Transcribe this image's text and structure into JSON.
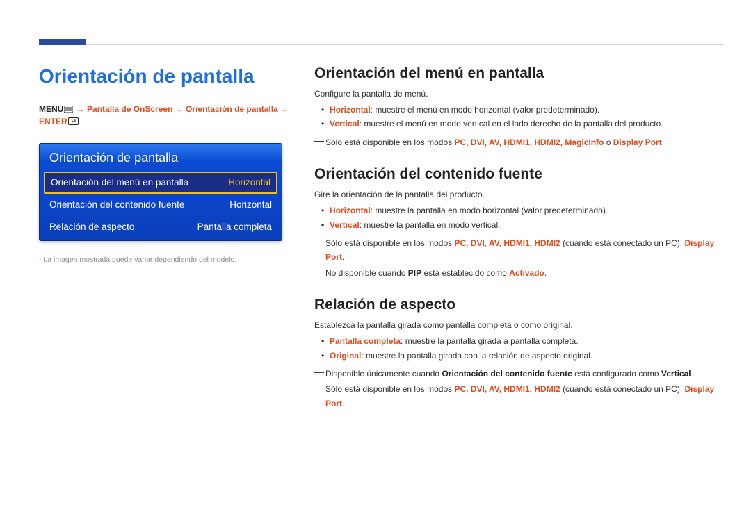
{
  "left": {
    "title": "Orientación de pantalla",
    "breadcrumb": {
      "menu_label": "MENU",
      "path_1": " → Pantalla de OnScreen → Orientación de pantalla → ENTER"
    },
    "osd": {
      "title": "Orientación de pantalla",
      "rows": [
        {
          "label": "Orientación del menú en pantalla",
          "value": "Horizontal",
          "selected": true
        },
        {
          "label": "Orientación del contenido fuente",
          "value": "Horizontal",
          "selected": false
        },
        {
          "label": "Relación de aspecto",
          "value": "Pantalla completa",
          "selected": false
        }
      ]
    },
    "footnote_prefix": "-",
    "footnote": "La imagen mostrada puede variar dependiendo del modelo."
  },
  "right": {
    "section1": {
      "heading": "Orientación del menú en pantalla",
      "intro": "Configure la pantalla de menú.",
      "bullet1_strong": "Horizontal",
      "bullet1_rest": ": muestre el menú en modo horizontal (valor predeterminado).",
      "bullet2_strong": "Vertical",
      "bullet2_rest": ": muestre el menú en modo vertical en el lado derecho de la pantalla del producto.",
      "note1_a": "Sólo está disponible en los modos ",
      "note1_modes": "PC, DVI, AV, HDMI1, HDMI2, MagicInfo",
      "note1_o": " o ",
      "note1_dp": "Display Port",
      "note1_end": "."
    },
    "section2": {
      "heading": "Orientación del contenido fuente",
      "intro": "Gire la orientación de la pantalla del producto.",
      "bullet1_strong": "Horizontal",
      "bullet1_rest": ": muestre la pantalla en modo horizontal (valor predeterminado).",
      "bullet2_strong": "Vertical",
      "bullet2_rest": ": muestre la pantalla en modo vertical.",
      "note1_a": "Sólo está disponible en los modos ",
      "note1_modes": "PC, DVI, AV, HDMI1, HDMI2",
      "note1_mid": " (cuando está conectado un PC), ",
      "note1_dp": "Display Port",
      "note1_end": ".",
      "note2_a": "No disponible cuando ",
      "note2_pip": "PIP",
      "note2_mid": " está establecido como ",
      "note2_act": "Activado",
      "note2_end": "."
    },
    "section3": {
      "heading": "Relación de aspecto",
      "intro": "Establezca la pantalla girada como pantalla completa o como original.",
      "bullet1_strong": "Pantalla completa",
      "bullet1_rest": ": muestre la pantalla girada a pantalla completa.",
      "bullet2_strong": "Original",
      "bullet2_rest": ": muestre la pantalla girada con la relación de aspecto original.",
      "note1_a": "Disponible únicamente cuando ",
      "note1_b": "Orientación del contenido fuente",
      "note1_c": " está configurado como ",
      "note1_d": "Vertical",
      "note1_e": ".",
      "note2_a": "Sólo está disponible en los modos ",
      "note2_modes": "PC, DVI, AV, HDMI1, HDMI2",
      "note2_mid": " (cuando está conectado un PC), ",
      "note2_dp": "Display Port",
      "note2_end": "."
    }
  }
}
